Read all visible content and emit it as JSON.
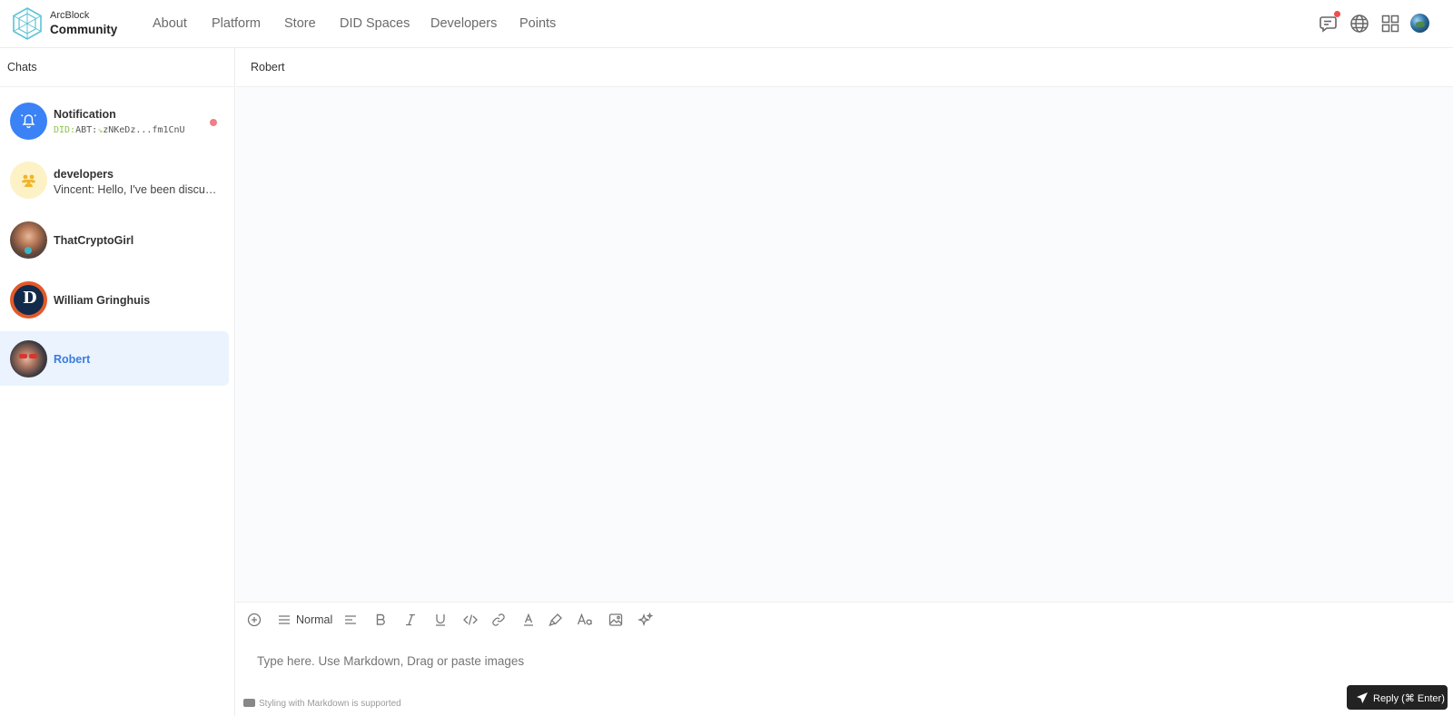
{
  "brand": {
    "top": "ArcBlock",
    "bottom": "Community"
  },
  "nav": {
    "items": [
      "About",
      "Platform",
      "Store",
      "DID Spaces",
      "Developers",
      "Points"
    ]
  },
  "header_icons": [
    "chat-notification-icon",
    "globe-icon",
    "apps-grid-icon",
    "user-avatar"
  ],
  "sidebar": {
    "title": "Chats",
    "chats": [
      {
        "name": "Notification",
        "did_prefix": "DID:",
        "did_mid": "ABT:",
        "did_value": "zNKeDz...fm1CnU",
        "unread": true
      },
      {
        "name": "developers",
        "preview": "Vincent: Hello, I've been discussing..."
      },
      {
        "name": "ThatCryptoGirl"
      },
      {
        "name": "William Gringhuis"
      },
      {
        "name": "Robert",
        "active": true
      }
    ]
  },
  "conversation": {
    "title": "Robert"
  },
  "composer": {
    "block_type": "Normal",
    "placeholder": "Type here. Use Markdown, Drag or paste images",
    "markdown_note": "Styling with Markdown is supported",
    "reply_label": "Reply (⌘ Enter)"
  },
  "colors": {
    "accent": "#3b82f6",
    "active_bg": "#eaf3fe",
    "active_text": "#3b7be0",
    "unread": "#f07f86"
  }
}
